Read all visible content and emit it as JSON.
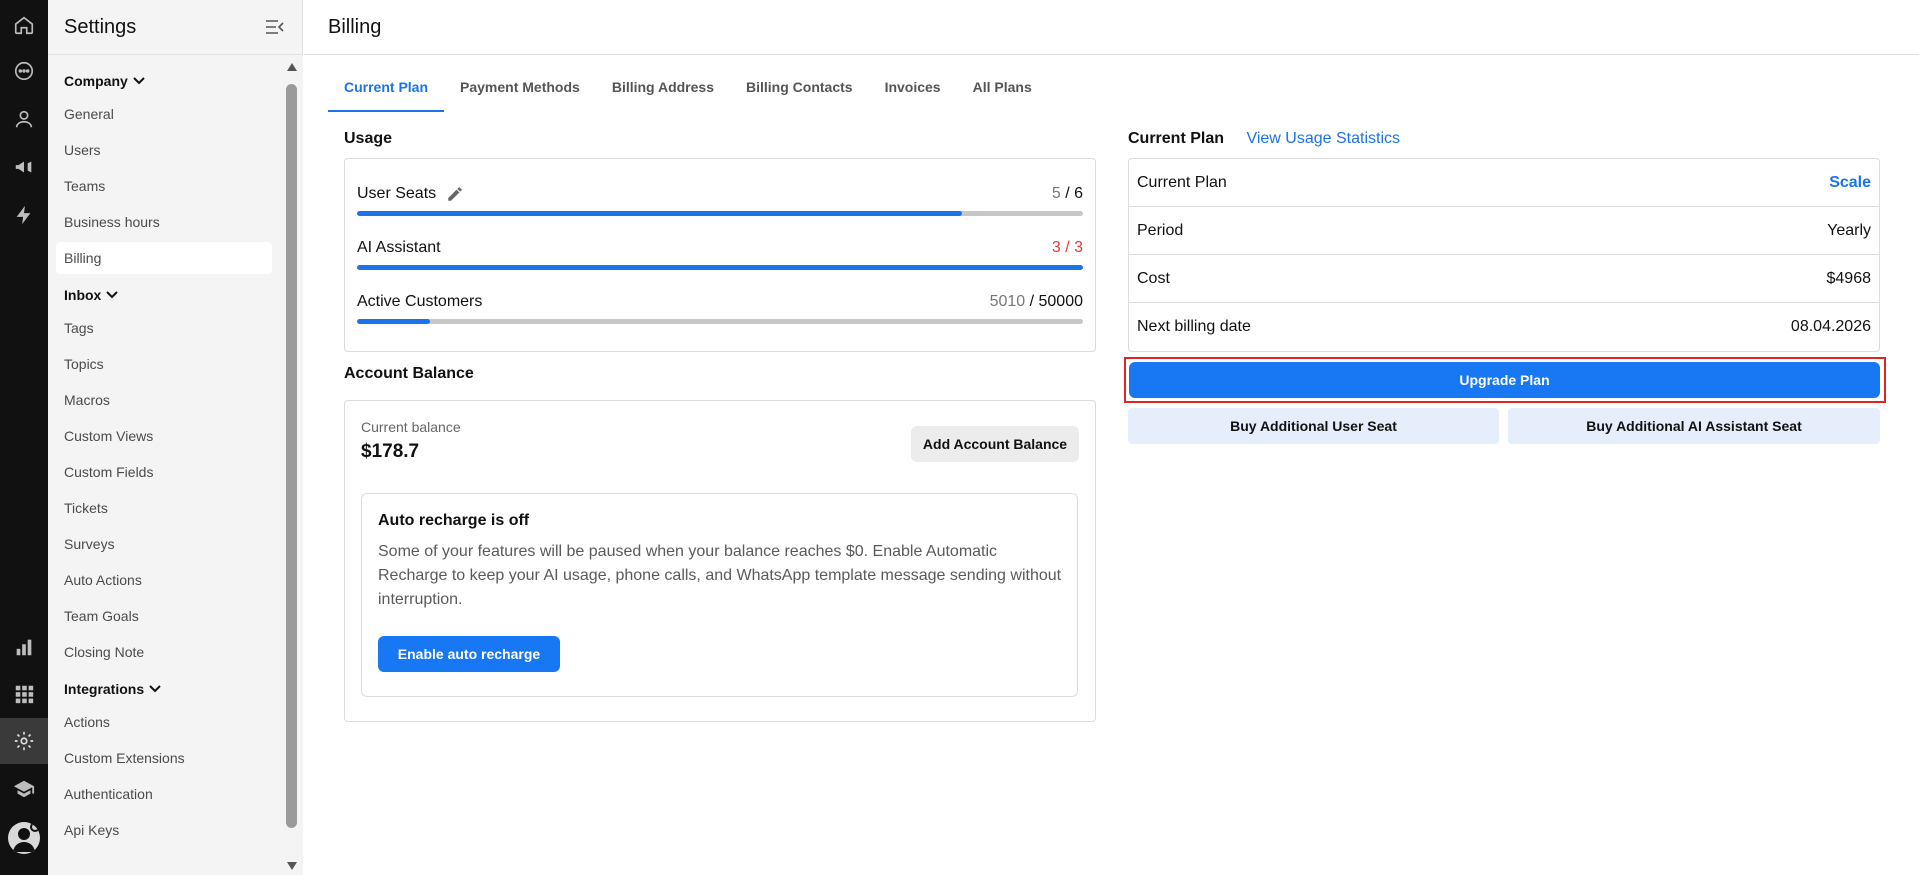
{
  "rail": {
    "items": [
      "home-icon",
      "chat-icon",
      "contacts-icon",
      "campaigns-icon",
      "automation-icon",
      "reports-icon",
      "apps-grid-icon",
      "settings-icon",
      "academy-icon"
    ]
  },
  "sidebar": {
    "title": "Settings",
    "groups": [
      {
        "label": "Company",
        "items": [
          "General",
          "Users",
          "Teams",
          "Business hours",
          "Billing"
        ]
      },
      {
        "label": "Inbox",
        "items": [
          "Tags",
          "Topics",
          "Macros",
          "Custom Views",
          "Custom Fields",
          "Tickets",
          "Surveys",
          "Auto Actions",
          "Team Goals",
          "Closing Note"
        ]
      },
      {
        "label": "Integrations",
        "items": [
          "Actions",
          "Custom Extensions",
          "Authentication",
          "Api Keys"
        ]
      }
    ],
    "active_item": "Billing"
  },
  "header": {
    "title": "Billing"
  },
  "tabs": [
    {
      "label": "Current Plan",
      "active": true
    },
    {
      "label": "Payment Methods",
      "active": false
    },
    {
      "label": "Billing Address",
      "active": false
    },
    {
      "label": "Billing Contacts",
      "active": false
    },
    {
      "label": "Invoices",
      "active": false
    },
    {
      "label": "All Plans",
      "active": false
    }
  ],
  "usage": {
    "title": "Usage",
    "stats_link": "View Usage Statistics",
    "rows": [
      {
        "label": "User Seats",
        "used": "5",
        "sep": " / ",
        "total": "6",
        "fraction": 0.833,
        "editable": true,
        "danger": false
      },
      {
        "label": "AI Assistant",
        "used": "3",
        "sep": " / ",
        "total": "3",
        "fraction": 1.0,
        "editable": false,
        "danger": true
      },
      {
        "label": "Active Customers",
        "used": "5010",
        "sep": " / ",
        "total": "50000",
        "fraction": 0.1,
        "editable": false,
        "danger": false
      }
    ]
  },
  "balance": {
    "title": "Account Balance",
    "current_label": "Current balance",
    "current_value": "$178.7",
    "add_button": "Add Account Balance",
    "auto_recharge": {
      "title": "Auto recharge is off",
      "text": "Some of your features will be paused when your balance reaches $0. Enable Automatic Recharge to keep your AI usage, phone calls, and WhatsApp template message sending without interruption.",
      "button": "Enable auto recharge"
    }
  },
  "plan": {
    "title": "Current Plan",
    "rows": [
      {
        "label": "Current Plan",
        "value": "Scale",
        "accent": true
      },
      {
        "label": "Period",
        "value": "Yearly",
        "accent": false
      },
      {
        "label": "Cost",
        "value": "$4968",
        "accent": false
      },
      {
        "label": "Next billing date",
        "value": "08.04.2026",
        "accent": false
      }
    ],
    "upgrade_button": "Upgrade Plan",
    "buy_user_seat": "Buy Additional User Seat",
    "buy_ai_seat": "Buy Additional AI Assistant Seat"
  },
  "colors": {
    "accent": "#1a73e8",
    "primary_button": "#1877f2",
    "danger": "#e53935",
    "highlight": "#e02424"
  }
}
